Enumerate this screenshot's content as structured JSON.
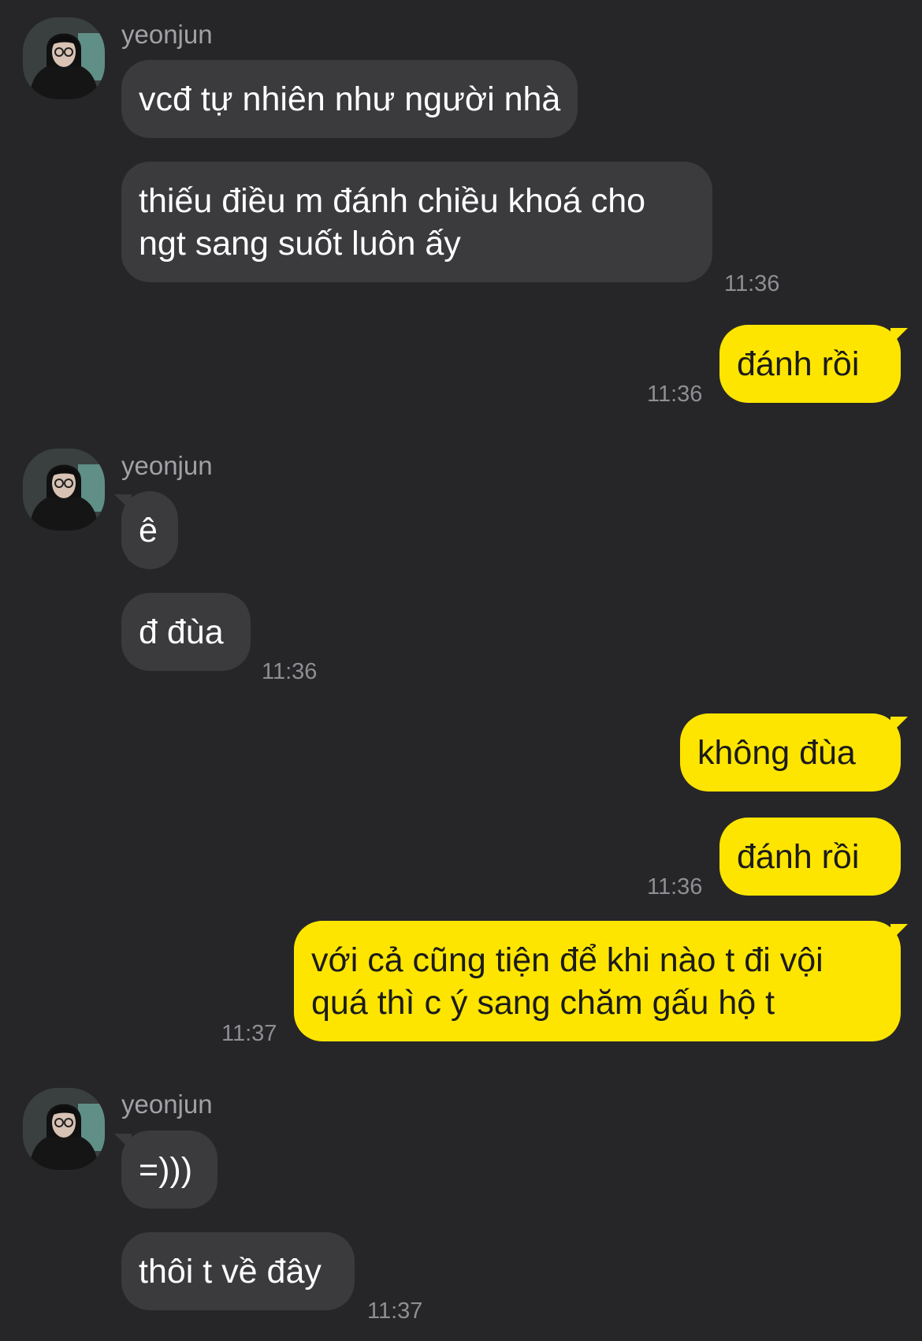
{
  "messages": [
    {
      "sender": "yeonjun",
      "text": "vcđ tự nhiên như người nhà"
    },
    {
      "text_lines": [
        "thiếu điều m đánh chiều khoá cho",
        "ngt sang suốt luôn ấy"
      ],
      "time": "11:36"
    },
    {
      "text": "đánh rồi",
      "time": "11:36"
    },
    {
      "sender": "yeonjun",
      "text": "ê"
    },
    {
      "text": "đ đùa",
      "time": "11:36"
    },
    {
      "text": "không đùa"
    },
    {
      "text": "đánh rồi",
      "time": "11:36"
    },
    {
      "text_lines": [
        "với cả cũng tiện để khi nào t đi vội",
        "quá thì c ý sang chăm gấu hộ t"
      ],
      "time": "11:37"
    },
    {
      "sender": "yeonjun",
      "text": "=)))"
    },
    {
      "text": "thôi t về đây",
      "time": "11:37"
    }
  ],
  "colors": {
    "background": "#262628",
    "incoming_bubble": "#3b3b3e",
    "outgoing_bubble": "#fee500",
    "timestamp": "#8e8e93",
    "sender_name": "#a1a1a6"
  },
  "icons": {
    "avatar": "profile-photo-avatar"
  }
}
